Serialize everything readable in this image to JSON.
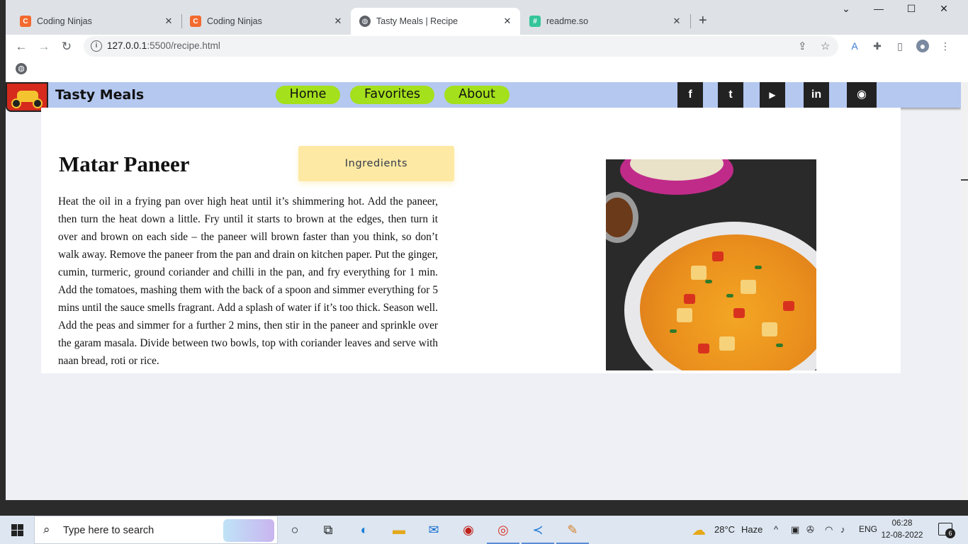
{
  "browser": {
    "tabs": [
      {
        "title": "Coding Ninjas",
        "close": "✕",
        "favicon_color": "#f26a2e"
      },
      {
        "title": "Coding Ninjas",
        "close": "✕",
        "favicon_color": "#f26a2e"
      },
      {
        "title": "Tasty Meals | Recipe",
        "close": "✕",
        "favicon_color": "#5f6368"
      },
      {
        "title": "readme.so",
        "close": "✕",
        "favicon_color": "#34c59a"
      }
    ],
    "new_tab": "+",
    "window_controls": {
      "dropdown": "⌄",
      "minimize": "—",
      "maximize": "☐",
      "close": "✕"
    },
    "url_host": "127.0.0.1",
    "url_rest": ":5500/recipe.html"
  },
  "site": {
    "brand": "Tasty Meals",
    "nav": {
      "home": "Home",
      "favorites": "Favorites",
      "about": "About"
    },
    "social": {
      "facebook": "f",
      "twitter": "t",
      "youtube": "▶",
      "linkedin": "in",
      "github": "◉"
    }
  },
  "recipe": {
    "title": "Matar Paneer",
    "ingredients_button": "Ingredients",
    "instructions": "Heat the oil in a frying pan over high heat until it’s shimmering hot. Add the paneer, then turn the heat down a little. Fry until it starts to brown at the edges, then turn it over and brown on each side – the paneer will brown faster than you think, so don’t walk away. Remove the paneer from the pan and drain on kitchen paper. Put the ginger, cumin, turmeric, ground coriander and chilli in the pan, and fry everything for 1 min. Add the tomatoes, mashing them with the back of a spoon and simmer everything for 5 mins until the sauce smells fragrant. Add a splash of water if it’s too thick. Season well. Add the peas and simmer for a further 2 mins, then stir in the paneer and sprinkle over the garam masala. Divide between two bowls, top with coriander leaves and serve with naan bread, roti or rice."
  },
  "taskbar": {
    "search_placeholder": "Type here to search",
    "weather_temp": "28°C",
    "weather_desc": "Haze",
    "language": "ENG",
    "time": "06:28",
    "date": "12-08-2022",
    "notification_count": "6"
  },
  "colors": {
    "nav_bg": "#b4c8f0",
    "nav_link": "#a4e01c",
    "ingredients_bg": "#fde9a3",
    "page_bg": "#eef0f5"
  }
}
